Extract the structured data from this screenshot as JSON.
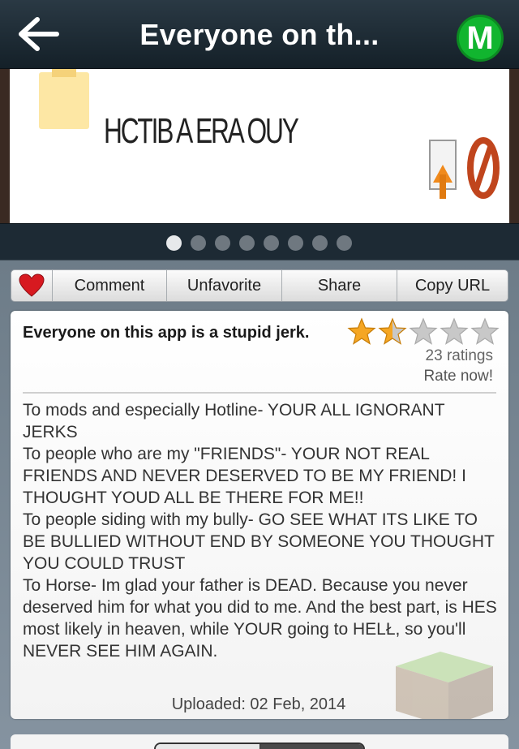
{
  "header": {
    "back_icon": "arrow-left-icon",
    "title": "Everyone on th...",
    "badge_letter": "M",
    "badge_color": "#11b52f"
  },
  "image": {
    "text": "HCTIB A ERA OUY",
    "icons": [
      "sticky-note-icon",
      "upload-icon",
      "prohibited-icon"
    ]
  },
  "pager": {
    "count": 8,
    "active_index": 0
  },
  "actions": {
    "favorite_icon": "heart-icon",
    "comment": "Comment",
    "unfavorite": "Unfavorite",
    "share": "Share",
    "copy_url": "Copy URL"
  },
  "post": {
    "title": "Everyone on this app is a stupid jerk.",
    "rating": 1.5,
    "rating_max": 5,
    "ratings_count": "23 ratings",
    "rate_now": "Rate now!",
    "paragraphs": [
      "To mods and especially Hotline- YOUR ALL IGNORANT JERKS",
      "To people who are my \"FRIENDS\"- YOUR NOT REAL FRIENDS AND NEVER DESERVED TO BE MY FRIEND! I THOUGHT YOUD ALL BE THERE FOR ME!!",
      "To people siding with my bully- GO SEE WHAT ITS LIKE TO BE BULLIED WITHOUT END BY SOMEONE YOU THOUGHT YOU COULD TRUST",
      "To Horse- Im glad your father is DEAD. Because you never deserved him for what you did to me. And the best part, is HES most likely in heaven, while YOUR going to HELŁ, so you'll NEVER SEE HIM AGAIN."
    ],
    "uploaded": "Uploaded: 02 Feb, 2014",
    "watermark_icon": "grass-block-icon"
  },
  "colors": {
    "star_filled": "#f5a623",
    "star_empty": "#c8c8c8",
    "heart": "#d71920"
  }
}
